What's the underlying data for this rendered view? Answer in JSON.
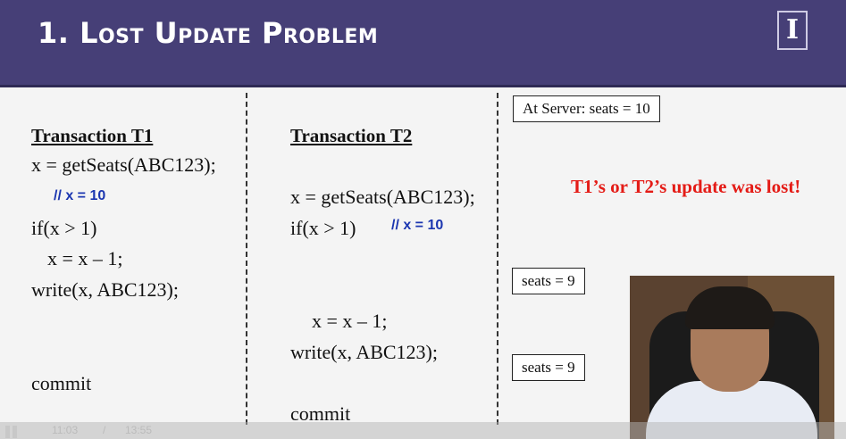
{
  "slide": {
    "title": "1. Lost Update Problem",
    "logo_letter": "I"
  },
  "t1": {
    "heading": "Transaction T1",
    "lines": [
      "x = getSeats(ABC123);",
      "if(x > 1)",
      "x = x – 1;",
      "write(x, ABC123);",
      "commit"
    ],
    "comment": "// x = 10"
  },
  "t2": {
    "heading": "Transaction T2",
    "lines": [
      "x = getSeats(ABC123);",
      "if(x > 1)",
      "x = x – 1;",
      "write(x, ABC123);",
      "commit"
    ],
    "comment": "// x = 10"
  },
  "server": {
    "initial": "At Server: seats = 10",
    "after_t1": "seats = 9",
    "after_t2": "seats = 9",
    "note": "T1’s or T2’s update was lost!"
  },
  "player": {
    "current_time": "11:03",
    "separator": "/",
    "duration": "13:55"
  },
  "colors": {
    "title_bar": "#463f77",
    "comment": "#1b36b0",
    "alert": "#e41b16"
  }
}
